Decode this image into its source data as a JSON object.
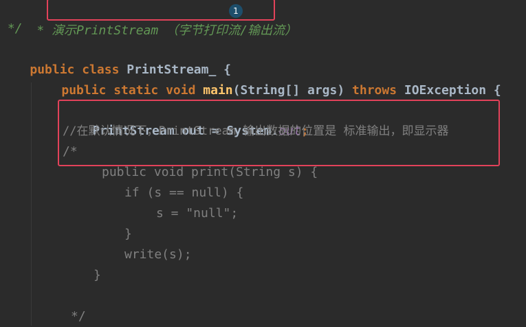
{
  "code": {
    "line1": {
      "star": "* ",
      "prefix": "演示",
      "name": "PrintStream",
      "suffix": " （字节打印流/输出流）"
    },
    "line2": " */",
    "line3": {
      "kw1": "public class ",
      "cls": "PrintStream_",
      "rest": " {"
    },
    "line4": {
      "kw1": "public static void ",
      "fn": "main",
      "params": "(String[] args) ",
      "kw2": "throws ",
      "exc": "IOException",
      "rest": " {"
    },
    "line5": {
      "type": "PrintStream out = System.",
      "field": "out",
      "semi": ";"
    },
    "line6": "//在默认情况下，PrintStream 输出数据的位置是 标准输出，即显示器",
    "line7": "/*",
    "line8": "public void print(String s) {",
    "line9": "if (s == null) {",
    "line10": "s = \"null\";",
    "line11": "}",
    "line12": "write(s);",
    "line13": "}",
    "line14": "*/"
  },
  "cursor": {
    "badge": "1"
  },
  "colors": {
    "background": "#2b2b2b",
    "keyword": "#cc7832",
    "method": "#ffc66d",
    "doc_comment": "#629755",
    "comment": "#808080",
    "field": "#9876aa",
    "highlight_box": "#e3425a"
  }
}
